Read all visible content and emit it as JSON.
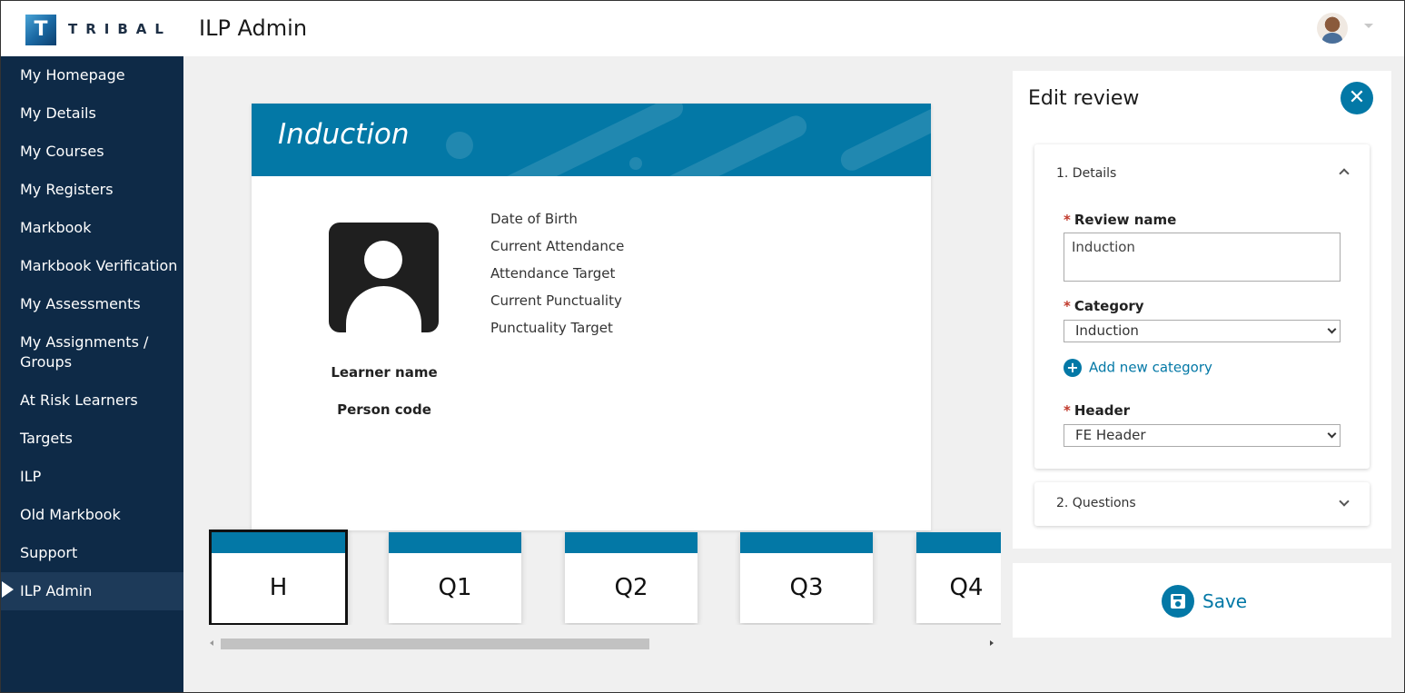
{
  "header": {
    "logo_letter": "T",
    "logo_text": "TRIBAL",
    "app_title": "ILP Admin"
  },
  "sidebar": {
    "items": [
      {
        "label": "My Homepage"
      },
      {
        "label": "My Details"
      },
      {
        "label": "My Courses"
      },
      {
        "label": "My Registers"
      },
      {
        "label": "Markbook"
      },
      {
        "label": "Markbook Verification"
      },
      {
        "label": "My Assessments"
      },
      {
        "label": "My Assignments /"
      },
      {
        "label": "Groups"
      },
      {
        "label": "At Risk Learners"
      },
      {
        "label": "Targets"
      },
      {
        "label": "ILP"
      },
      {
        "label": "Old Markbook"
      },
      {
        "label": "Support"
      },
      {
        "label": "ILP Admin"
      }
    ],
    "active": "ILP Admin"
  },
  "preview": {
    "title": "Induction",
    "learner_name": "Learner name",
    "person_code": "Person code",
    "info": [
      "Date of Birth",
      "Current Attendance",
      "Attendance Target",
      "Current Punctuality",
      "Punctuality Target"
    ]
  },
  "tabs": [
    {
      "label": "H",
      "selected": true
    },
    {
      "label": "Q1"
    },
    {
      "label": "Q2"
    },
    {
      "label": "Q3"
    },
    {
      "label": "Q4"
    }
  ],
  "panel": {
    "title": "Edit review",
    "section1_title": "1. Details",
    "review_name_label": "Review name",
    "review_name_value": "Induction",
    "category_label": "Category",
    "category_value": "Induction",
    "add_category": "Add new category",
    "header_label": "Header",
    "header_value": "FE Header",
    "section2_title": "2. Questions",
    "required_mark": "*"
  },
  "save": {
    "label": "Save"
  },
  "colors": {
    "brand_blue": "#0378a6",
    "sidebar": "#0e2a47",
    "required": "#c0392b"
  }
}
